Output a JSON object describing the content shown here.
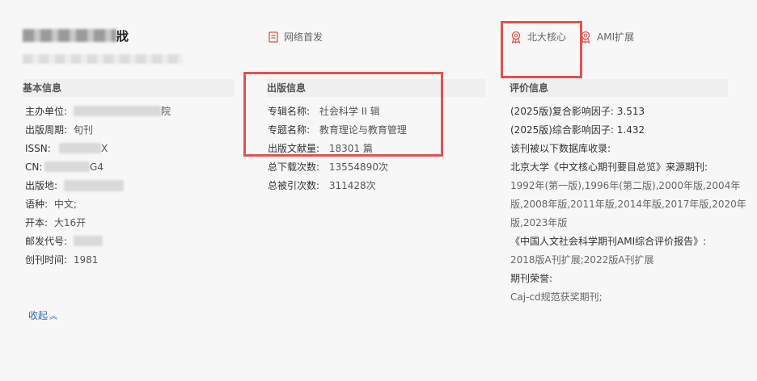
{
  "header": {
    "title_tail": "戕",
    "tags": {
      "network_first": "网络首发",
      "pku_core": "北大核心",
      "ami": "AMI扩展"
    }
  },
  "basic": {
    "heading": "基本信息",
    "items": [
      {
        "label": "主办单位:",
        "value": "院"
      },
      {
        "label": "出版周期:",
        "value": "旬刊"
      },
      {
        "label": "ISSN:",
        "value": "X"
      },
      {
        "label": "CN:",
        "value": "G4"
      },
      {
        "label": "出版地:",
        "value": ""
      },
      {
        "label": "语种:",
        "value": "中文;"
      },
      {
        "label": "开本:",
        "value": "大16开"
      },
      {
        "label": "邮发代号:",
        "value": ""
      },
      {
        "label": "创刊时间:",
        "value": "1981"
      }
    ],
    "collapse_label": "收起"
  },
  "publish": {
    "heading": "出版信息",
    "items": [
      {
        "label": "专辑名称:",
        "value": "社会科学 II 辑"
      },
      {
        "label": "专题名称:",
        "value": "教育理论与教育管理"
      },
      {
        "label": "出版文献量:",
        "value": "18301 篇"
      },
      {
        "label": "总下载次数:",
        "value": "13554890次"
      },
      {
        "label": "总被引次数:",
        "value": "311428次"
      }
    ]
  },
  "evaluation": {
    "heading": "评价信息",
    "lines": [
      "(2025版)复合影响因子: 3.513",
      "(2025版)综合影响因子: 1.432",
      "该刊被以下数据库收录:",
      "北京大学《中文核心期刊要目总览》来源期刊:",
      "1992年(第一版),1996年(第二版),2000年版,2004年",
      "版,2008年版,2011年版,2014年版,2017年版,2020年",
      "版,2023年版",
      "《中国人文社会科学期刊AMI综合评价报告》:",
      "2018版A刊扩展;2022版A刊扩展",
      "期刊荣誉:",
      "Caj-cd规范获奖期刊;"
    ]
  },
  "colors": {
    "highlight_border": "#e05252",
    "link": "#2a6ab8",
    "icon_red": "#d9534f"
  }
}
